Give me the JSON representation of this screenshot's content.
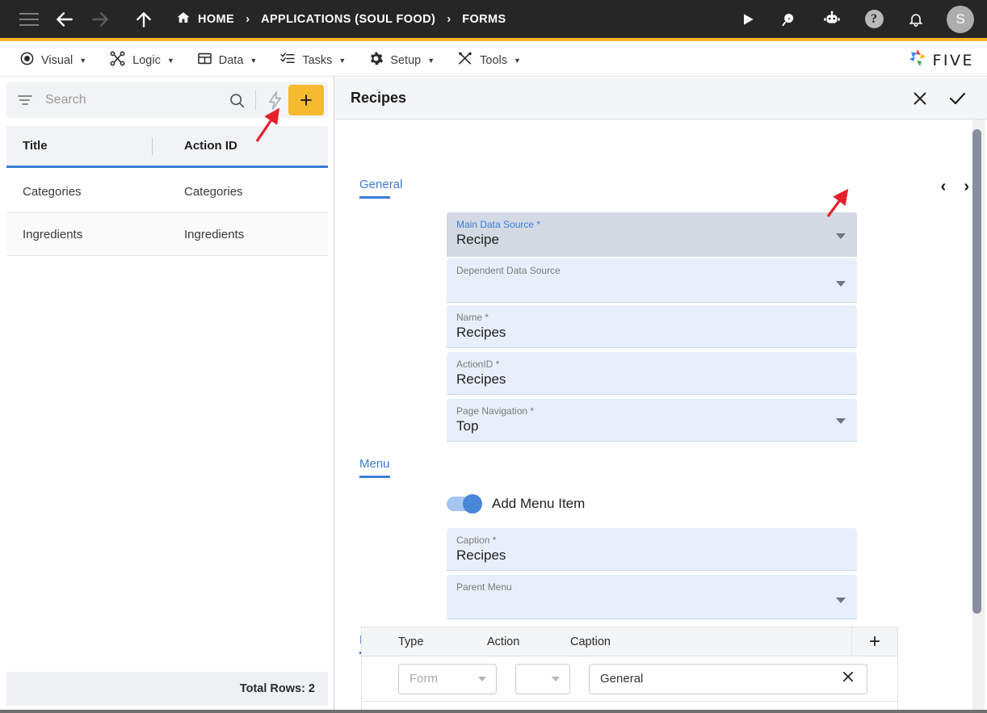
{
  "topbar": {
    "icons": {
      "menu": "hamburger-menu-icon",
      "back": "back-arrow-icon",
      "forward": "forward-arrow-icon",
      "up": "up-arrow-icon",
      "home": "home-icon",
      "run": "play-icon",
      "search": "search-chat-icon",
      "bot": "robot-icon",
      "help": "help-icon",
      "bell": "notification-bell-icon"
    },
    "breadcrumbs": [
      {
        "label": "HOME",
        "icon": "home-icon"
      },
      {
        "label": "APPLICATIONS (SOUL FOOD)"
      },
      {
        "label": "FORMS"
      }
    ],
    "separator": "›",
    "help_glyph": "?",
    "avatar_initial": "S",
    "accent": "#f5b427"
  },
  "menubar": {
    "items": [
      {
        "label": "Visual",
        "icon": "eye-icon"
      },
      {
        "label": "Logic",
        "icon": "nodes-icon"
      },
      {
        "label": "Data",
        "icon": "table-icon"
      },
      {
        "label": "Tasks",
        "icon": "checklist-icon"
      },
      {
        "label": "Setup",
        "icon": "gear-icon"
      },
      {
        "label": "Tools",
        "icon": "wrench-screwdriver-icon"
      }
    ],
    "caret": "▼",
    "brand": "FIVE"
  },
  "left": {
    "search": {
      "placeholder": "Search",
      "value": ""
    },
    "search_icon": "magnifier-icon",
    "filter_icon": "filter-icon",
    "flash_icon": "lightning-bolt-icon",
    "add_label": "+",
    "grid": {
      "columns": [
        "Title",
        "Action ID"
      ],
      "rows": [
        {
          "title": "Categories",
          "action_id": "Categories"
        },
        {
          "title": "Ingredients",
          "action_id": "Ingredients"
        }
      ]
    },
    "total_rows": "Total Rows: 2"
  },
  "form": {
    "title": "Recipes",
    "close_label": "✕",
    "confirm_label": "✓",
    "prev_label": "‹",
    "next_label": "›",
    "sections": {
      "general": "General",
      "menu": "Menu",
      "pages": "Pages"
    },
    "fields": {
      "main_data_source": {
        "label": "Main Data Source *",
        "value": "Recipe",
        "type": "select",
        "focused": true
      },
      "dependent_data_source": {
        "label": "Dependent Data Source",
        "value": "",
        "type": "select",
        "focused": false
      },
      "name": {
        "label": "Name *",
        "value": "Recipes",
        "type": "text"
      },
      "action_id": {
        "label": "ActionID *",
        "value": "Recipes",
        "type": "text"
      },
      "page_navigation": {
        "label": "Page Navigation *",
        "value": "Top",
        "type": "select"
      },
      "caption": {
        "label": "Caption *",
        "value": "Recipes",
        "type": "text"
      },
      "parent_menu": {
        "label": "Parent Menu",
        "value": "",
        "type": "select"
      }
    },
    "menu_toggle": {
      "label": "Add Menu Item",
      "on": true
    },
    "pages_table": {
      "columns": [
        "Type",
        "Action",
        "Caption"
      ],
      "add_label": "+",
      "rows": [
        {
          "type": "Form",
          "action": "",
          "caption": "General",
          "clear": "✕"
        }
      ]
    }
  },
  "annotations": [
    {
      "name": "arrow-to-flash-icon",
      "target": "lightning-bolt-icon"
    },
    {
      "name": "arrow-to-main-data-source-dropdown",
      "target": "main-data-source-caret"
    }
  ],
  "colors": {
    "accent_yellow": "#f5b427",
    "accent_blue": "#3b7dd8",
    "field_blue": "#e7f0fa",
    "field_focused": "#d3dae3",
    "topbar_dark": "#262626",
    "annotation_red": "#e8202a"
  }
}
